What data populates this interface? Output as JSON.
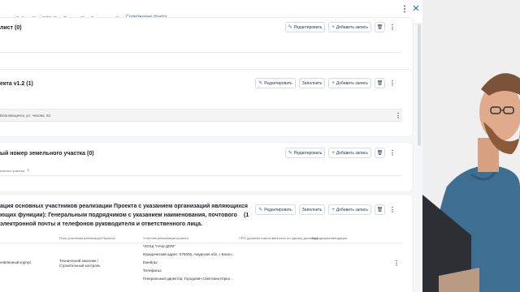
{
  "header": {
    "more_icon": "kebab-vertical-icon",
    "close_icon": "close-icon"
  },
  "tabs": [
    {
      "label": "орот",
      "count": ""
    },
    {
      "label": "Файлы",
      "count": "0"
    },
    {
      "label": "ЗДО",
      "count": "0"
    },
    {
      "label": "Задачи",
      "count": "0"
    },
    {
      "label": "Замечания",
      "count": "0"
    },
    {
      "label": "Содержание отчета",
      "count": "",
      "active": true
    }
  ],
  "buttons": {
    "edit": "Редактировать",
    "fill": "Заполнить",
    "add": "Добавить запись"
  },
  "cards": [
    {
      "title": "лист (0)"
    },
    {
      "title": "екта v1.2 (1)",
      "row_text": "Благовещенск, ул. Чехова, 52"
    },
    {
      "title": "ый номер земельного участка (0)",
      "col_label": "ельного участка"
    },
    {
      "title_line1": "ация основных участников реализации Проекта с указанием организаций являющихся",
      "title_line2": "ющих функции): Генеральным подрядчиком с указанием наименования, почтового",
      "title_line3": "электронной почты и телефонов руководителя и ответственного лица.",
      "count": "(1",
      "columns": [
        "Роль участника реализации Проекта",
        "Участник реализации проекта",
        "СРО (уровень ответственности по одному договору)",
        "Выводы/рекомендации"
      ],
      "row": {
        "first_col": "новленный корпус",
        "role": "Технический заказчик / Строительный контроль",
        "participant_lines": [
          "ЧОУШ \"НАШ ДОМ\"",
          "Юридический адрес: 675005, Амурская обл.,г Благо...",
          "Емейлы:",
          "Телефоны:",
          "Генеральный директор: Городович Светлана Юрье..."
        ]
      }
    }
  ]
}
